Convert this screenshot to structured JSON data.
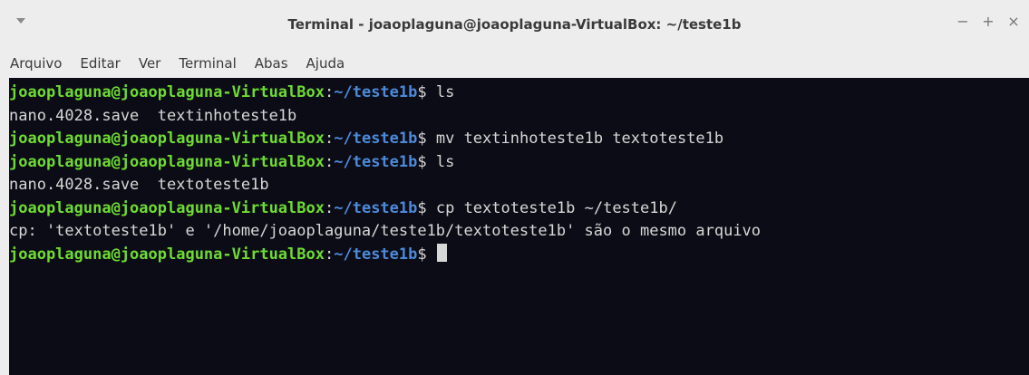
{
  "window": {
    "title": "Terminal - joaoplaguna@joaoplaguna-VirtualBox: ~/teste1b",
    "controls": {
      "minimize": "−",
      "maximize": "+",
      "close": "×"
    }
  },
  "menubar": {
    "items": [
      "Arquivo",
      "Editar",
      "Ver",
      "Terminal",
      "Abas",
      "Ajuda"
    ]
  },
  "terminal": {
    "colors": {
      "background": "#0c0c16",
      "user": "#6ddc32",
      "path": "#4c8ad9",
      "text": "#d7d7d7"
    },
    "lines": [
      {
        "user": "joaoplaguna@joaoplaguna-VirtualBox",
        "path": "~/teste1b",
        "prompt": "$ ",
        "command": "ls"
      },
      {
        "output": "nano.4028.save  textinhoteste1b"
      },
      {
        "user": "joaoplaguna@joaoplaguna-VirtualBox",
        "path": "~/teste1b",
        "prompt": "$ ",
        "command": "mv textinhoteste1b textoteste1b"
      },
      {
        "user": "joaoplaguna@joaoplaguna-VirtualBox",
        "path": "~/teste1b",
        "prompt": "$ ",
        "command": "ls"
      },
      {
        "output": "nano.4028.save  textoteste1b"
      },
      {
        "user": "joaoplaguna@joaoplaguna-VirtualBox",
        "path": "~/teste1b",
        "prompt": "$ ",
        "command": "cp textoteste1b ~/teste1b/"
      },
      {
        "output": "cp: 'textoteste1b' e '/home/joaoplaguna/teste1b/textoteste1b' são o mesmo arquivo"
      },
      {
        "user": "joaoplaguna@joaoplaguna-VirtualBox",
        "path": "~/teste1b",
        "prompt": "$ ",
        "command": "",
        "cursor": true
      }
    ]
  }
}
